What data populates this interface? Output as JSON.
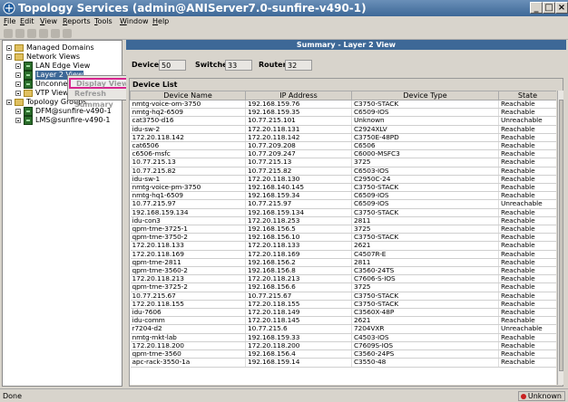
{
  "window": {
    "title": "Topology Services (admin@ANIServer7.0-sunfire-v490-1)"
  },
  "menu": [
    "File",
    "Edit",
    "View",
    "Reports",
    "Tools",
    "Window",
    "Help"
  ],
  "tree": {
    "managed_domains": "Managed Domains",
    "network_views": "Network Views",
    "lan_edge_view": "LAN Edge View",
    "layer2_view": "Layer 2 View",
    "unconnected": "Unconnec",
    "vtp_views": "VTP Views",
    "topology_groups": "Topology Groups",
    "dfm": "DFM@sunfire-v490-1",
    "lms": "LMS@sunfire-v490-1"
  },
  "context_menu": {
    "display_view": "Display View",
    "refresh_summary": "Refresh Summary"
  },
  "summary": {
    "title": "Summary - Layer 2 View",
    "devices_label": "Devices",
    "devices_value": "50",
    "switches_label": "Switches",
    "switches_value": "33",
    "routers_label": "Routers",
    "routers_value": "32"
  },
  "device_list": {
    "title": "Device List",
    "columns": [
      "Device Name",
      "IP Address",
      "Device Type",
      "State"
    ],
    "rows": [
      [
        "nmtg-voice-om-3750",
        "192.168.159.76",
        "C3750-STACK",
        "Reachable"
      ],
      [
        "nmtg-hq2-6509",
        "192.168.159.35",
        "C6509-IOS",
        "Reachable"
      ],
      [
        "cat3750-d16",
        "10.77.215.101",
        "Unknown",
        "Unreachable"
      ],
      [
        "idu-sw-2",
        "172.20.118.131",
        "C2924XLV",
        "Reachable"
      ],
      [
        "172.20.118.142",
        "172.20.118.142",
        "C3750E-48PD",
        "Reachable"
      ],
      [
        "cat6506",
        "10.77.209.208",
        "C6506",
        "Reachable"
      ],
      [
        "c6506-msfc",
        "10.77.209.247",
        "C6000-MSFC3",
        "Reachable"
      ],
      [
        "10.77.215.13",
        "10.77.215.13",
        "3725",
        "Reachable"
      ],
      [
        "10.77.215.82",
        "10.77.215.82",
        "C6503-IOS",
        "Reachable"
      ],
      [
        "idu-sw-1",
        "172.20.118.130",
        "C2950C-24",
        "Reachable"
      ],
      [
        "nmtg-voice-pm-3750",
        "192.168.140.145",
        "C3750-STACK",
        "Reachable"
      ],
      [
        "nmtg-hq1-6509",
        "192.168.159.34",
        "C6509-IOS",
        "Reachable"
      ],
      [
        "10.77.215.97",
        "10.77.215.97",
        "C6509-IOS",
        "Unreachable"
      ],
      [
        "192.168.159.134",
        "192.168.159.134",
        "C3750-STACK",
        "Reachable"
      ],
      [
        "idu-con3",
        "172.20.118.253",
        "2811",
        "Reachable"
      ],
      [
        "qpm-tme-3725-1",
        "192.168.156.5",
        "3725",
        "Reachable"
      ],
      [
        "qpm-tme-3750-2",
        "192.168.156.10",
        "C3750-STACK",
        "Reachable"
      ],
      [
        "172.20.118.133",
        "172.20.118.133",
        "2621",
        "Reachable"
      ],
      [
        "172.20.118.169",
        "172.20.118.169",
        "C4507R-E",
        "Reachable"
      ],
      [
        "qpm-tme-2811",
        "192.168.156.2",
        "2811",
        "Reachable"
      ],
      [
        "qpm-tme-3560-2",
        "192.168.156.8",
        "C3560-24TS",
        "Reachable"
      ],
      [
        "172.20.118.213",
        "172.20.118.213",
        "C7606-S-IOS",
        "Reachable"
      ],
      [
        "qpm-tme-3725-2",
        "192.168.156.6",
        "3725",
        "Reachable"
      ],
      [
        "10.77.215.67",
        "10.77.215.67",
        "C3750-STACK",
        "Reachable"
      ],
      [
        "172.20.118.155",
        "172.20.118.155",
        "C3750-STACK",
        "Reachable"
      ],
      [
        "idu-7606",
        "172.20.118.149",
        "C3560X-48P",
        "Reachable"
      ],
      [
        "idu-comm",
        "172.20.118.145",
        "2621",
        "Reachable"
      ],
      [
        "r7204-d2",
        "10.77.215.6",
        "7204VXR",
        "Unreachable"
      ],
      [
        "nmtg-mkt-lab",
        "192.168.159.33",
        "C4503-IOS",
        "Reachable"
      ],
      [
        "172.20.118.200",
        "172.20.118.200",
        "C7609S-IOS",
        "Reachable"
      ],
      [
        "qpm-tme-3560",
        "192.168.156.4",
        "C3560-24PS",
        "Reachable"
      ],
      [
        "apc-rack-3550-1a",
        "192.168.159.14",
        "C3550-48",
        "Reachable"
      ]
    ]
  },
  "status": {
    "left": "Done",
    "right": "Unknown"
  }
}
